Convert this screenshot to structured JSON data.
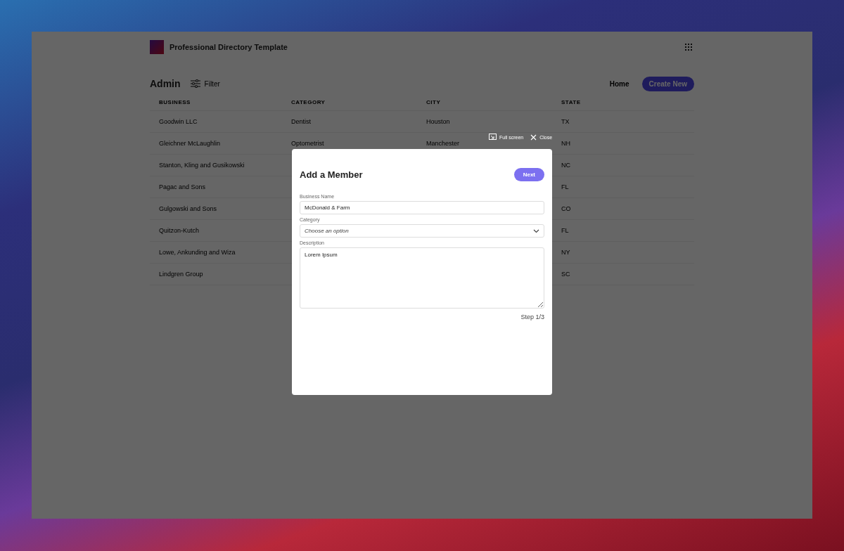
{
  "app": {
    "title": "Professional Directory Template"
  },
  "toolbar": {
    "heading": "Admin",
    "filter": "Filter",
    "home": "Home",
    "create": "Create New"
  },
  "table": {
    "columns": [
      "BUSINESS",
      "CATEGORY",
      "CITY",
      "STATE"
    ],
    "rows": [
      {
        "business": "Goodwin LLC",
        "category": "Dentist",
        "city": "Houston",
        "state": "TX"
      },
      {
        "business": "Gleichner McLaughlin",
        "category": "Optometrist",
        "city": "Manchester",
        "state": "NH"
      },
      {
        "business": "Stanton, Kling and Gusikowski",
        "state": "NC"
      },
      {
        "business": "Pagac and Sons",
        "state": "FL"
      },
      {
        "business": "Gulgowski and Sons",
        "state": "CO"
      },
      {
        "business": "Quitzon-Kutch",
        "state": "FL"
      },
      {
        "business": "Lowe, Ankunding and Wiza",
        "state": "NY"
      },
      {
        "business": "Lindgren Group",
        "state": "SC"
      }
    ]
  },
  "modal_controls": {
    "fullscreen": "Full screen",
    "close": "Close"
  },
  "modal": {
    "title": "Add a Member",
    "next": "Next",
    "fields": [
      {
        "kind": "text",
        "label": "Business Name",
        "value": "McDonald & Farm"
      },
      {
        "kind": "select",
        "label": "Category",
        "placeholder": "Choose an option"
      },
      {
        "kind": "textarea",
        "label": "Description",
        "value": "Lorem Ipsum"
      }
    ],
    "step": "Step 1/3"
  }
}
